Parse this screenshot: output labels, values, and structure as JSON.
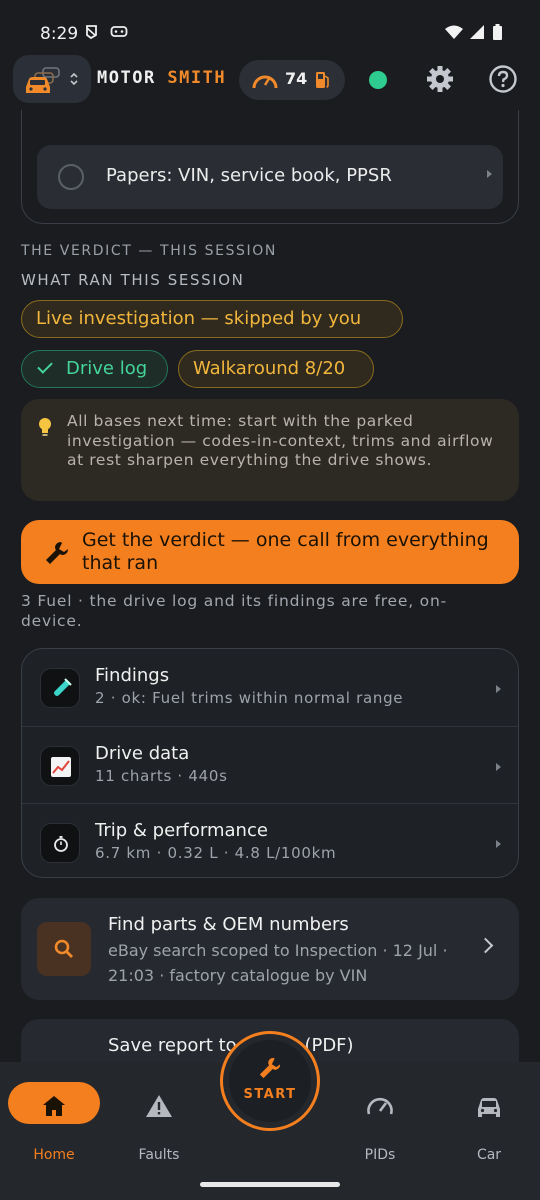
{
  "status_bar": {
    "time": "8:29"
  },
  "header": {
    "brand_part1": "MOTOR ",
    "brand_part2": "SMITH",
    "fuel_count": "74",
    "accent": "#f47f1f",
    "status_color": "#2ecc8f"
  },
  "papers_item": {
    "label": "Papers: VIN, service book, PPSR"
  },
  "session": {
    "verdict_label": "THE VERDICT — THIS SESSION",
    "ran_label": "WHAT RAN THIS SESSION",
    "chips": {
      "live": "Live investigation — skipped by you",
      "drive_log": "Drive log",
      "walkaround": "Walkaround 8/20"
    },
    "tip": "All bases next time: start with the parked investigation — codes-in-context, trims and airflow at rest sharpen everything the drive shows."
  },
  "verdict_button": {
    "label": "Get the verdict — one call from everything that ran"
  },
  "fuel_note": "3 Fuel · the drive log and its findings are free, on-device.",
  "results": [
    {
      "title": "Findings",
      "subtitle": "2 · ok: Fuel trims within normal range",
      "icon": "test-tube-icon"
    },
    {
      "title": "Drive data",
      "subtitle": "11 charts · 440s",
      "icon": "chart-icon"
    },
    {
      "title": "Trip & performance",
      "subtitle": "6.7 km · 0.32 L · 4.8 L/100km",
      "icon": "stopwatch-icon"
    }
  ],
  "parts": {
    "title": "Find parts & OEM numbers",
    "subtitle": "eBay search scoped to Inspection · 12 Jul · 21:03 · factory catalogue by VIN"
  },
  "report": {
    "title": "Save report to phone (PDF)"
  },
  "nav": {
    "home": "Home",
    "faults": "Faults",
    "start": "START",
    "pids": "PIDs",
    "car": "Car"
  }
}
